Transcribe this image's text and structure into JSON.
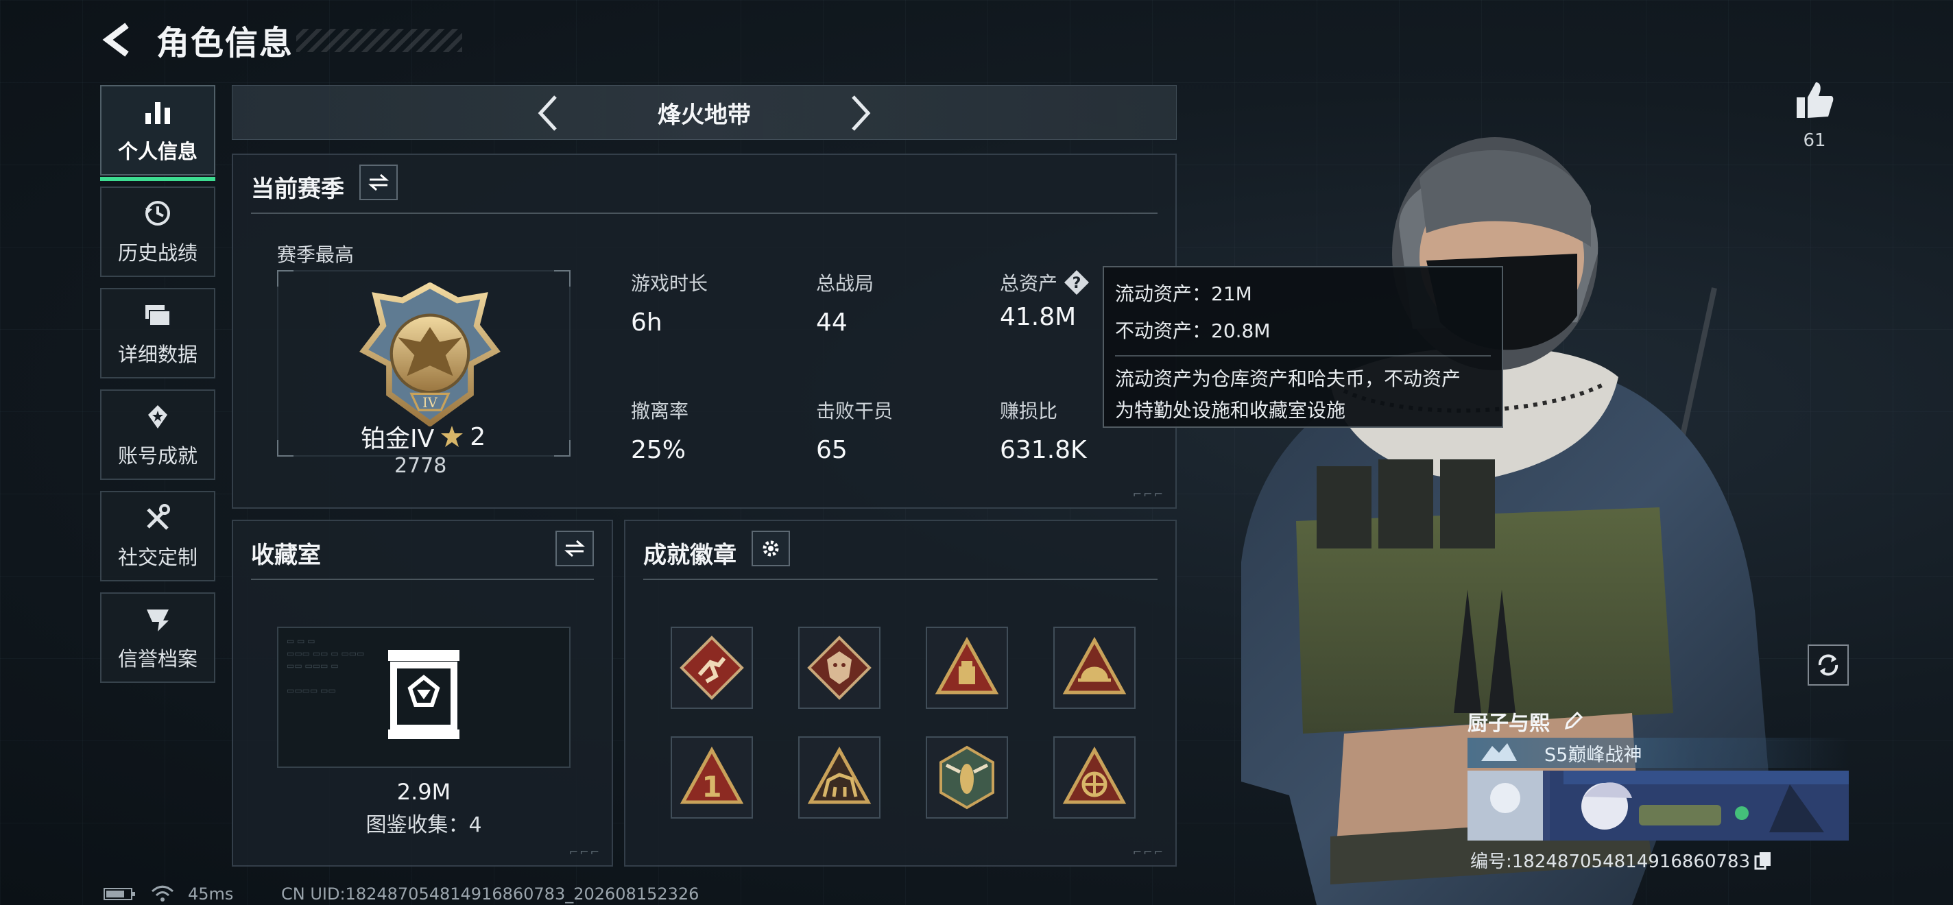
{
  "header": {
    "title": "角色信息"
  },
  "nav": {
    "items": [
      {
        "label": "个人信息",
        "icon": "bar-chart-icon",
        "active": true
      },
      {
        "label": "历史战绩",
        "icon": "history-icon"
      },
      {
        "label": "详细数据",
        "icon": "folders-icon"
      },
      {
        "label": "账号成就",
        "icon": "achievement-icon"
      },
      {
        "label": "社交定制",
        "icon": "tools-icon"
      },
      {
        "label": "信誉档案",
        "icon": "reputation-icon"
      }
    ]
  },
  "mode": {
    "title": "烽火地带"
  },
  "season": {
    "title": "当前赛季",
    "subtitle": "赛季最高",
    "rank_name": "铂金IV",
    "rank_stars": "2",
    "rank_score": "2778",
    "stats": [
      {
        "label": "游戏时长",
        "value": "6h"
      },
      {
        "label": "总战局",
        "value": "44"
      },
      {
        "label": "总资产",
        "value": "41.8M"
      },
      {
        "label": "撤离率",
        "value": "25%"
      },
      {
        "label": "击败干员",
        "value": "65"
      },
      {
        "label": "赚损比",
        "value": "631.8K"
      }
    ]
  },
  "tooltip": {
    "line1": "流动资产：21M",
    "line2": "不动资产：20.8M",
    "desc1": "流动资产为仓库资产和哈夫币，不动资产",
    "desc2": "为特勤处设施和收藏室设施"
  },
  "collection": {
    "title": "收藏室",
    "value": "2.9M",
    "count": "图鉴收集：4"
  },
  "achievements": {
    "title": "成就徽章",
    "badges": [
      "runner-badge",
      "dragon-badge",
      "crate-badge",
      "helmet-badge",
      "number-one-badge",
      "beast-badge",
      "wasp-badge",
      "crest-badge"
    ]
  },
  "profile": {
    "likes": "61",
    "player_name": "厨子与熙",
    "title_text": "S5巅峰战神",
    "uid_text": "编号:18248705481491686078​3"
  },
  "status": {
    "ping": "45ms",
    "cn_uid": "CN UID:18248705481491686078​3_202608152326"
  },
  "colors": {
    "accent": "#3ddc91",
    "panel_bg": "#18202a",
    "gold": "#c9a25a",
    "badge_red": "#8c2a22"
  }
}
